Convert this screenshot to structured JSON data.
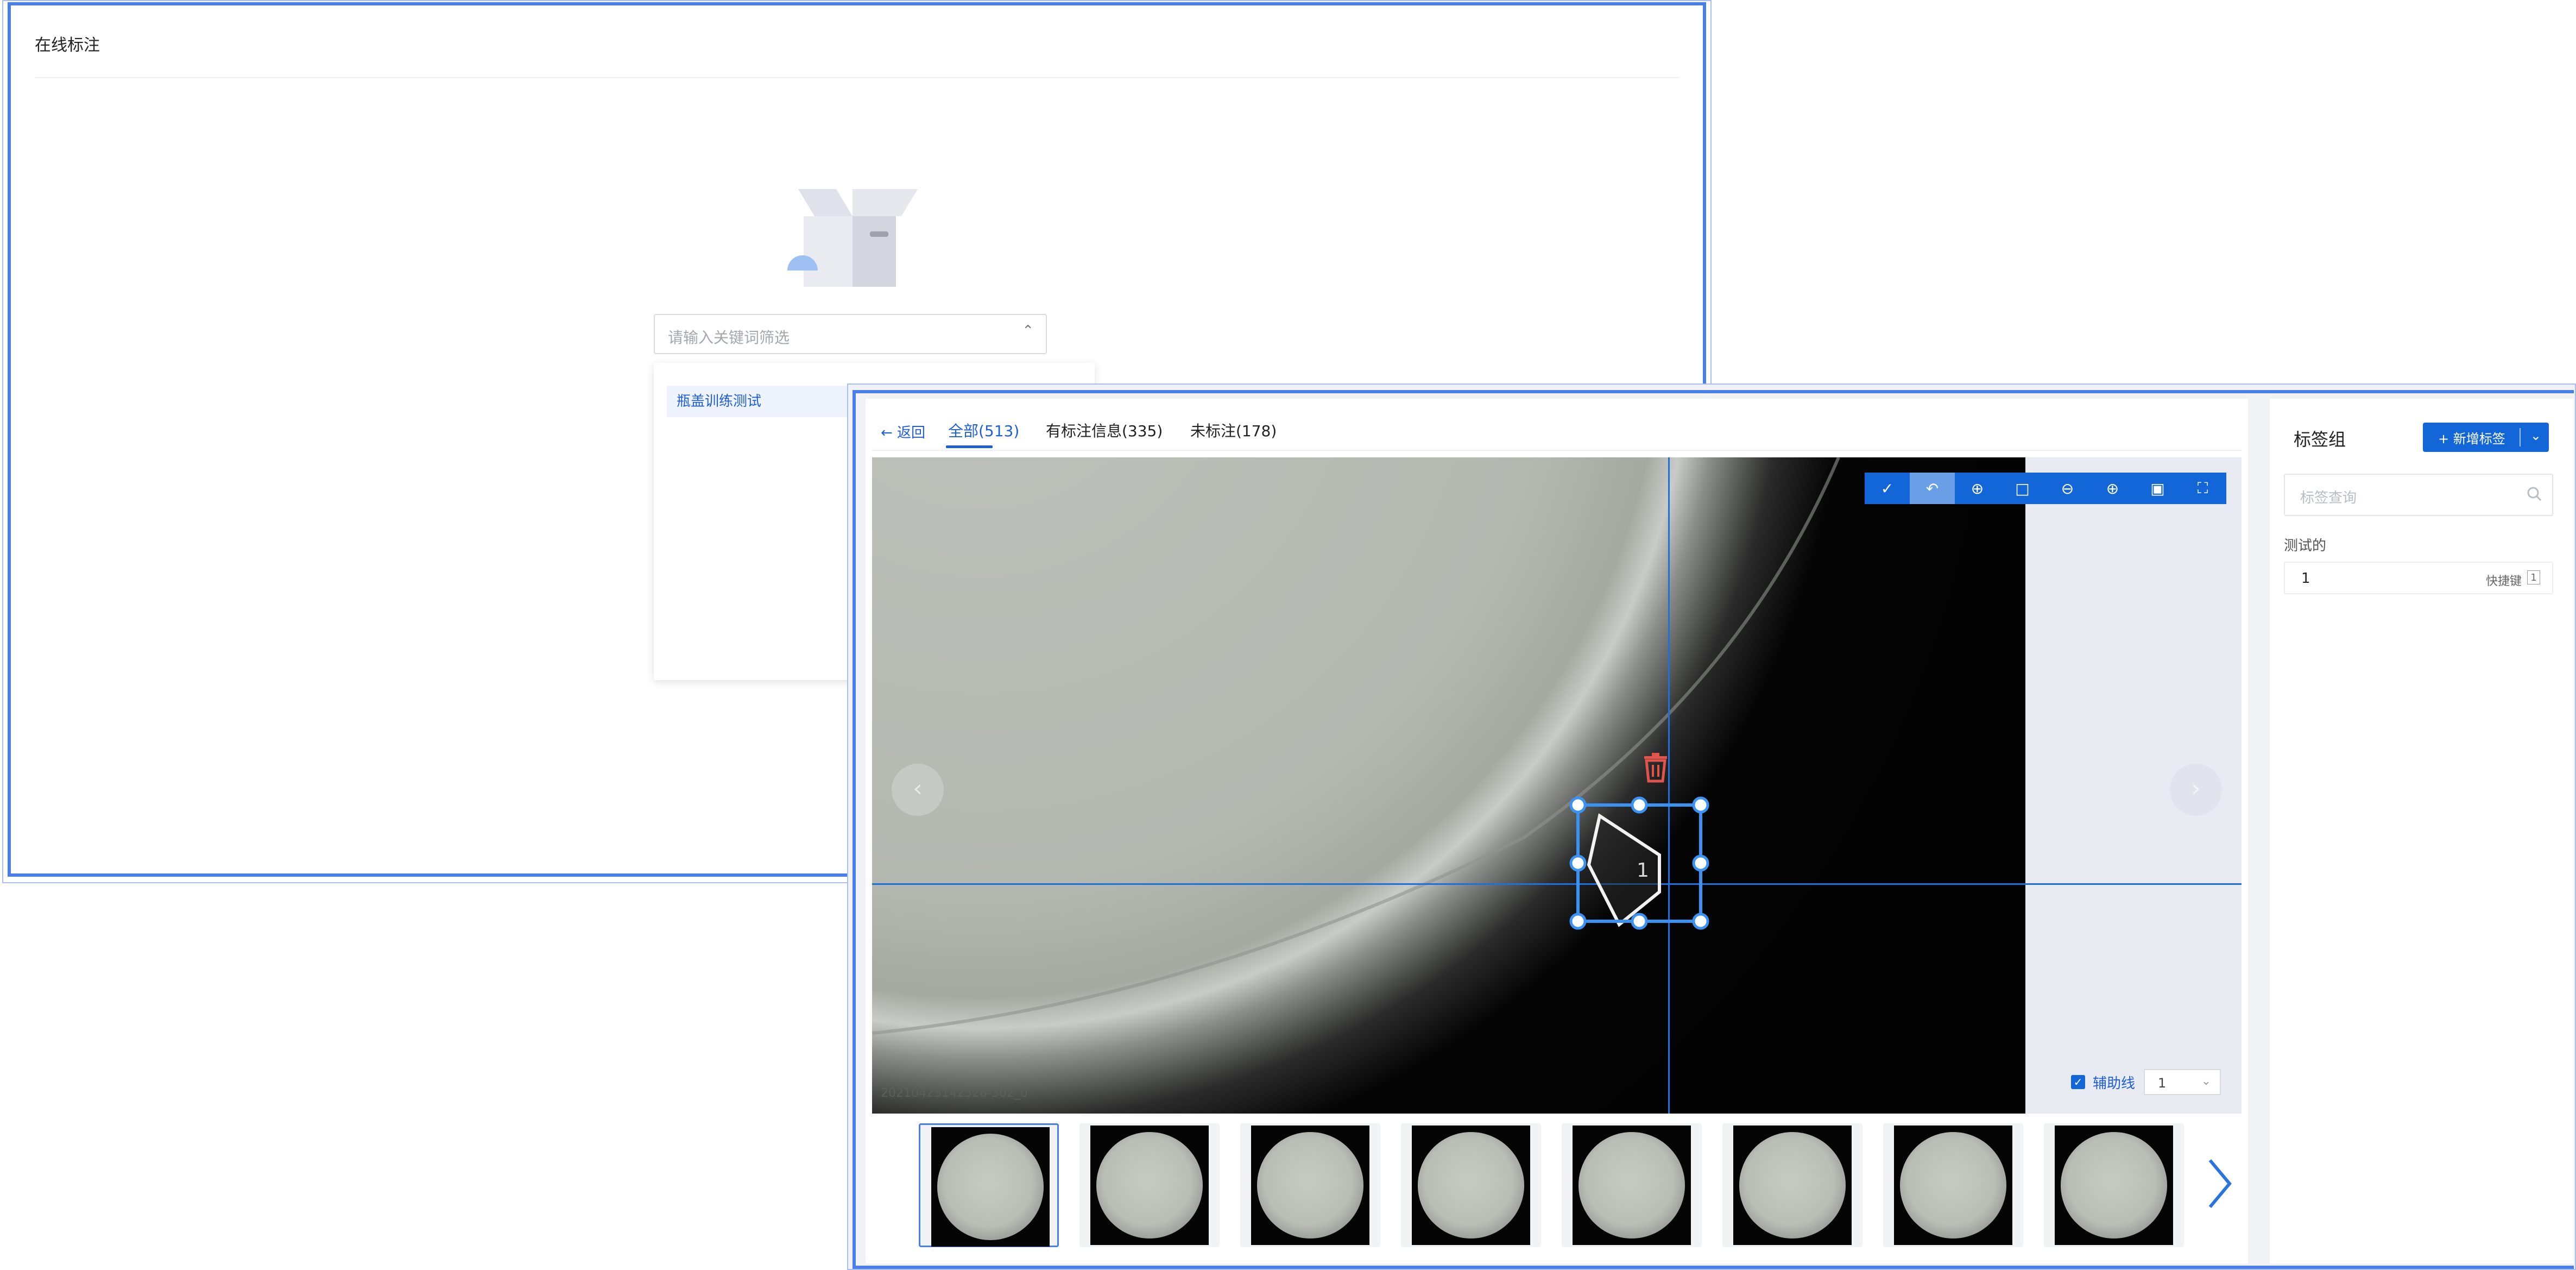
{
  "back_window": {
    "title": "在线标注",
    "keyword_filter": {
      "placeholder": "请输入关键词筛选"
    },
    "dropdown_options": [
      "瓶盖训练测试"
    ]
  },
  "workbench": {
    "back_label": "← 返回",
    "tabs": [
      {
        "label": "全部(513)",
        "active": true
      },
      {
        "label": "有标注信息(335)",
        "active": false
      },
      {
        "label": "未标注(178)",
        "active": false
      }
    ],
    "file_name": "20210423142526-302_0",
    "annotation": {
      "label": "1"
    },
    "aux_line": {
      "label": "辅助线",
      "checked": true,
      "select_value": "1"
    },
    "toolbar_icons": [
      "brush-icon",
      "undo-icon",
      "crosshair-icon",
      "crop-icon",
      "zoom-out-icon",
      "zoom-in-icon",
      "save-icon",
      "fullscreen-icon"
    ],
    "thumbnail_count": 8
  },
  "label_panel": {
    "title": "标签组",
    "add_button": "+ 新增标签",
    "search_placeholder": "标签查询",
    "group_name": "测试的",
    "labels": [
      {
        "name": "1",
        "shortcut_label": "快捷键",
        "shortcut_key": "1"
      }
    ]
  },
  "colors": {
    "accent": "#1266d8",
    "frame": "#4a7ee8",
    "delete": "#e0544c"
  }
}
